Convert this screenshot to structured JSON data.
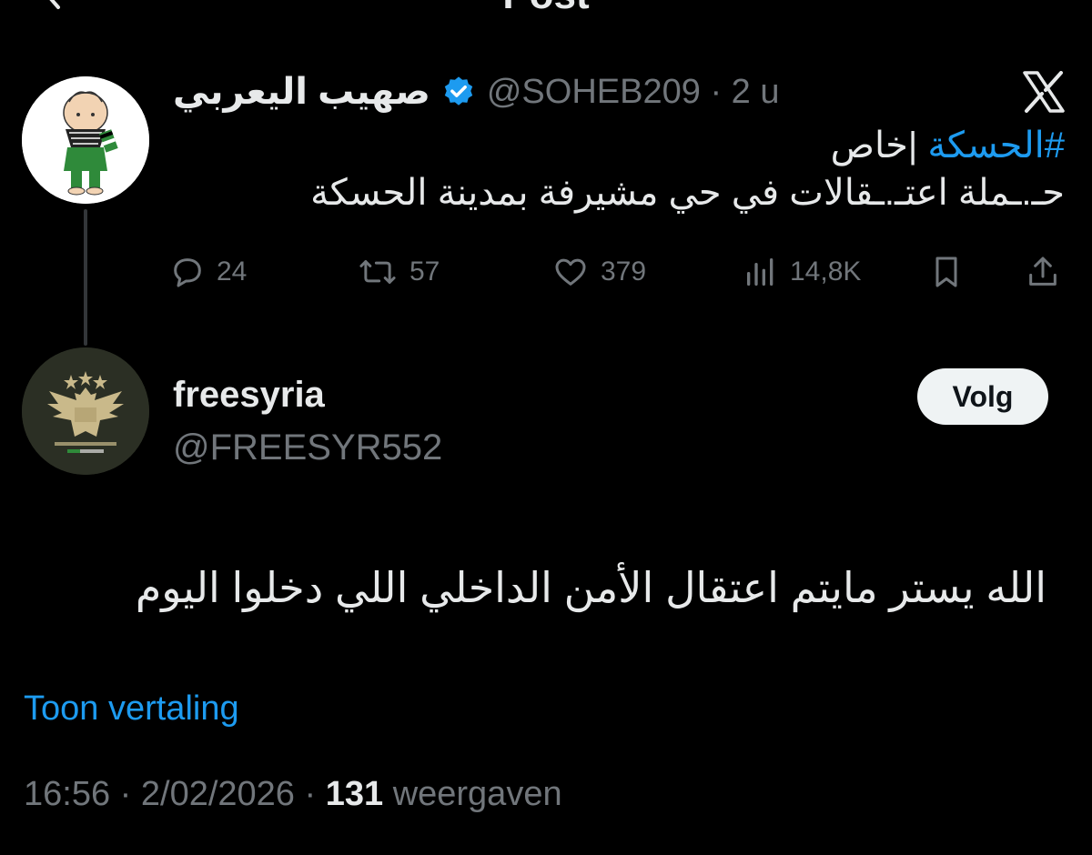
{
  "header": {
    "title": "Post"
  },
  "quoted_tweet": {
    "author_name": "صهيب اليعربي",
    "handle": "@SOHEB209",
    "separator": "·",
    "time": "2 u",
    "hashtag": "#الحسكة",
    "line1_rest": " |خاص",
    "line2": "حـ.ـملة اعتـ.ـقالات في حي مشيرفة بمدينة الحسكة",
    "stats": {
      "replies": "24",
      "reposts": "57",
      "likes": "379",
      "views": "14,8K"
    },
    "icons": [
      "reply-icon",
      "repost-icon",
      "like-icon",
      "views-icon",
      "bookmark-icon",
      "share-icon",
      "x-logo-icon",
      "verified-badge-icon"
    ]
  },
  "reply_tweet": {
    "author_name": "freesyria",
    "handle": "@FREESYR552",
    "follow_label": "Volg",
    "text": "الله يستر مايتم اعتقال الأمن الداخلي اللي دخلوا اليوم",
    "translate_label": "Toon vertaling",
    "time": "16:56",
    "date": "2/02/2026",
    "views_count": "131",
    "views_label": "weergaven",
    "dot": "·"
  },
  "colors": {
    "background": "#000000",
    "text_primary": "#e7e9ea",
    "text_secondary": "#71767b",
    "accent": "#1d9bf0"
  }
}
